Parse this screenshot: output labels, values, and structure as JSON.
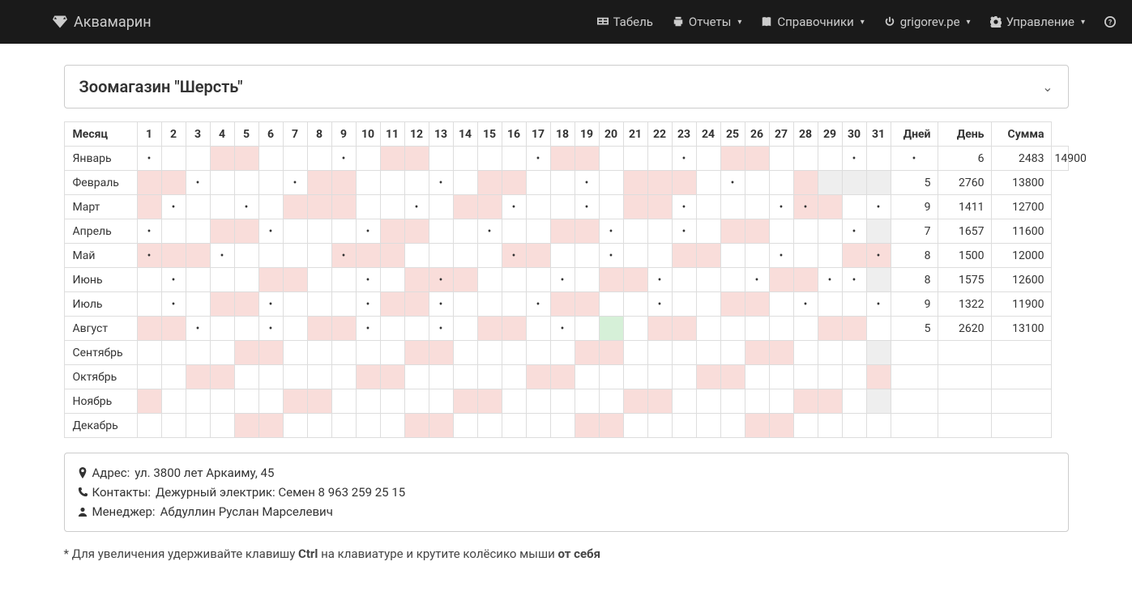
{
  "nav": {
    "brand": "Аквамарин",
    "tabel": "Табель",
    "reports": "Отчеты",
    "refs": "Справочники",
    "user": "grigorev.pe",
    "manage": "Управление"
  },
  "shop_title": "Зоомагазин \"Шерсть\"",
  "headers": {
    "month": "Месяц",
    "days": "Дней",
    "day": "День",
    "sum": "Сумма"
  },
  "day_numbers": [
    "1",
    "2",
    "3",
    "4",
    "5",
    "6",
    "7",
    "8",
    "9",
    "10",
    "11",
    "12",
    "13",
    "14",
    "15",
    "16",
    "17",
    "18",
    "19",
    "20",
    "21",
    "22",
    "23",
    "24",
    "25",
    "26",
    "27",
    "28",
    "29",
    "30",
    "31"
  ],
  "months": [
    {
      "name": "Январь",
      "cells": [
        {
          "d": 1
        },
        {
          "d": 0
        },
        {
          "d": 0
        },
        {
          "p": 1
        },
        {
          "p": 1
        },
        {
          "d": 0
        },
        {
          "d": 0
        },
        {
          "d": 0
        },
        {
          "d": 1
        },
        {
          "d": 0
        },
        {
          "p": 1
        },
        {
          "p": 1
        },
        {
          "d": 0
        },
        {
          "d": 0
        },
        {
          "d": 0
        },
        {
          "d": 0
        },
        {
          "d": 1
        },
        {
          "p": 1
        },
        {
          "p": 1
        },
        {
          "d": 0
        },
        {
          "d": 0
        },
        {
          "d": 0
        },
        {
          "d": 1
        },
        {
          "d": 0
        },
        {
          "p": 1
        },
        {
          "p": 1
        },
        {
          "d": 0
        },
        {
          "d": 0
        },
        {
          "d": 0
        },
        {
          "d": 1
        },
        {
          "d": 0
        },
        {
          "d": 1
        }
      ],
      "stats": {
        "days": "6",
        "day": "2483",
        "sum": "14900"
      }
    },
    {
      "name": "Февраль",
      "cells": [
        {
          "p": 1
        },
        {
          "p": 1
        },
        {
          "d": 1
        },
        {
          "d": 0
        },
        {
          "d": 0
        },
        {
          "d": 0
        },
        {
          "d": 1
        },
        {
          "p": 1
        },
        {
          "p": 1
        },
        {
          "d": 0
        },
        {
          "d": 0
        },
        {
          "d": 0
        },
        {
          "d": 1
        },
        {
          "d": 0
        },
        {
          "p": 1
        },
        {
          "p": 1
        },
        {
          "d": 0
        },
        {
          "d": 0
        },
        {
          "d": 1
        },
        {
          "d": 0
        },
        {
          "p": 1
        },
        {
          "p": 1
        },
        {
          "p": 1
        },
        {
          "d": 0
        },
        {
          "d": 1
        },
        {
          "d": 0
        },
        {
          "d": 0
        },
        {
          "p": 1
        },
        {
          "g": 1
        },
        {
          "g": 1
        },
        {
          "g": 1
        }
      ],
      "stats": {
        "days": "5",
        "day": "2760",
        "sum": "13800"
      }
    },
    {
      "name": "Март",
      "cells": [
        {
          "p": 1
        },
        {
          "d": 1
        },
        {
          "d": 0
        },
        {
          "d": 0
        },
        {
          "d": 1
        },
        {
          "d": 0
        },
        {
          "p": 1
        },
        {
          "p": 1
        },
        {
          "p": 1
        },
        {
          "d": 0
        },
        {
          "d": 0
        },
        {
          "d": 1
        },
        {
          "d": 0
        },
        {
          "p": 1
        },
        {
          "p": 1
        },
        {
          "d": 1
        },
        {
          "d": 0
        },
        {
          "d": 0
        },
        {
          "d": 1
        },
        {
          "d": 0
        },
        {
          "p": 1
        },
        {
          "p": 1
        },
        {
          "d": 1
        },
        {
          "d": 0
        },
        {
          "d": 0
        },
        {
          "d": 0
        },
        {
          "d": 1
        },
        {
          "p": 1,
          "d": 1
        },
        {
          "p": 1
        },
        {
          "d": 0
        },
        {
          "d": 1
        }
      ],
      "stats": {
        "days": "9",
        "day": "1411",
        "sum": "12700"
      }
    },
    {
      "name": "Апрель",
      "cells": [
        {
          "d": 1
        },
        {
          "d": 0
        },
        {
          "d": 0
        },
        {
          "p": 1
        },
        {
          "p": 1
        },
        {
          "d": 1
        },
        {
          "d": 0
        },
        {
          "d": 0
        },
        {
          "d": 0
        },
        {
          "d": 1
        },
        {
          "p": 1
        },
        {
          "p": 1
        },
        {
          "d": 0
        },
        {
          "d": 0
        },
        {
          "d": 1
        },
        {
          "d": 0
        },
        {
          "d": 0
        },
        {
          "p": 1
        },
        {
          "p": 1
        },
        {
          "d": 1
        },
        {
          "d": 0
        },
        {
          "d": 0
        },
        {
          "d": 1
        },
        {
          "d": 0
        },
        {
          "p": 1
        },
        {
          "p": 1
        },
        {
          "d": 0
        },
        {
          "d": 0
        },
        {
          "d": 0
        },
        {
          "d": 1
        },
        {
          "g": 1
        }
      ],
      "stats": {
        "days": "7",
        "day": "1657",
        "sum": "11600"
      }
    },
    {
      "name": "Май",
      "cells": [
        {
          "p": 1,
          "d": 1
        },
        {
          "p": 1
        },
        {
          "p": 1
        },
        {
          "d": 1
        },
        {
          "d": 0
        },
        {
          "d": 0
        },
        {
          "d": 0
        },
        {
          "d": 0
        },
        {
          "p": 1,
          "d": 1
        },
        {
          "p": 1
        },
        {
          "p": 1
        },
        {
          "d": 0
        },
        {
          "d": 0
        },
        {
          "d": 0
        },
        {
          "d": 0
        },
        {
          "p": 1,
          "d": 1
        },
        {
          "p": 1
        },
        {
          "d": 0
        },
        {
          "d": 0
        },
        {
          "d": 1
        },
        {
          "d": 0
        },
        {
          "d": 0
        },
        {
          "p": 1
        },
        {
          "p": 1
        },
        {
          "d": 0
        },
        {
          "d": 0
        },
        {
          "d": 1
        },
        {
          "d": 0
        },
        {
          "d": 0
        },
        {
          "p": 1
        },
        {
          "p": 1,
          "d": 1
        }
      ],
      "stats": {
        "days": "8",
        "day": "1500",
        "sum": "12000"
      }
    },
    {
      "name": "Июнь",
      "cells": [
        {
          "d": 0
        },
        {
          "d": 1
        },
        {
          "d": 0
        },
        {
          "d": 0
        },
        {
          "d": 0
        },
        {
          "p": 1
        },
        {
          "p": 1
        },
        {
          "d": 0
        },
        {
          "d": 0
        },
        {
          "d": 1
        },
        {
          "d": 0
        },
        {
          "p": 1
        },
        {
          "p": 1,
          "d": 1
        },
        {
          "p": 1
        },
        {
          "d": 0
        },
        {
          "d": 0
        },
        {
          "d": 0
        },
        {
          "d": 1
        },
        {
          "d": 0
        },
        {
          "p": 1
        },
        {
          "p": 1
        },
        {
          "d": 1
        },
        {
          "d": 0
        },
        {
          "d": 0
        },
        {
          "d": 0
        },
        {
          "d": 1
        },
        {
          "p": 1
        },
        {
          "p": 1
        },
        {
          "d": 1
        },
        {
          "d": 1
        },
        {
          "g": 1
        }
      ],
      "stats": {
        "days": "8",
        "day": "1575",
        "sum": "12600"
      }
    },
    {
      "name": "Июль",
      "cells": [
        {
          "d": 0
        },
        {
          "d": 1
        },
        {
          "d": 0
        },
        {
          "p": 1
        },
        {
          "p": 1
        },
        {
          "d": 1
        },
        {
          "d": 0
        },
        {
          "d": 0
        },
        {
          "d": 0
        },
        {
          "d": 1
        },
        {
          "p": 1
        },
        {
          "p": 1
        },
        {
          "d": 1
        },
        {
          "d": 0
        },
        {
          "d": 0
        },
        {
          "d": 0
        },
        {
          "d": 1
        },
        {
          "p": 1
        },
        {
          "p": 1
        },
        {
          "d": 0
        },
        {
          "d": 0
        },
        {
          "d": 1
        },
        {
          "d": 0
        },
        {
          "d": 0
        },
        {
          "p": 1
        },
        {
          "p": 1
        },
        {
          "d": 0
        },
        {
          "d": 1
        },
        {
          "d": 0
        },
        {
          "d": 0
        },
        {
          "d": 1
        }
      ],
      "stats": {
        "days": "9",
        "day": "1322",
        "sum": "11900"
      }
    },
    {
      "name": "Август",
      "cells": [
        {
          "p": 1
        },
        {
          "p": 1
        },
        {
          "d": 1
        },
        {
          "d": 0
        },
        {
          "d": 0
        },
        {
          "d": 1
        },
        {
          "d": 0
        },
        {
          "p": 1
        },
        {
          "p": 1
        },
        {
          "d": 1
        },
        {
          "d": 0
        },
        {
          "d": 0
        },
        {
          "d": 1
        },
        {
          "d": 0
        },
        {
          "p": 1
        },
        {
          "p": 1
        },
        {
          "d": 0
        },
        {
          "d": 1
        },
        {
          "d": 0
        },
        {
          "gr": 1
        },
        {
          "d": 0
        },
        {
          "p": 1
        },
        {
          "p": 1
        },
        {
          "d": 0
        },
        {
          "d": 0
        },
        {
          "d": 0
        },
        {
          "d": 0
        },
        {
          "d": 0
        },
        {
          "p": 1
        },
        {
          "p": 1
        },
        {
          "d": 0
        }
      ],
      "stats": {
        "days": "5",
        "day": "2620",
        "sum": "13100"
      }
    },
    {
      "name": "Сентябрь",
      "cells": [
        {
          "d": 0
        },
        {
          "d": 0
        },
        {
          "d": 0
        },
        {
          "d": 0
        },
        {
          "p": 1
        },
        {
          "p": 1
        },
        {
          "d": 0
        },
        {
          "d": 0
        },
        {
          "d": 0
        },
        {
          "d": 0
        },
        {
          "d": 0
        },
        {
          "p": 1
        },
        {
          "p": 1
        },
        {
          "d": 0
        },
        {
          "d": 0
        },
        {
          "d": 0
        },
        {
          "d": 0
        },
        {
          "d": 0
        },
        {
          "p": 1
        },
        {
          "p": 1
        },
        {
          "d": 0
        },
        {
          "d": 0
        },
        {
          "d": 0
        },
        {
          "d": 0
        },
        {
          "d": 0
        },
        {
          "p": 1
        },
        {
          "p": 1
        },
        {
          "d": 0
        },
        {
          "d": 0
        },
        {
          "d": 0
        },
        {
          "g": 1
        }
      ],
      "stats": {
        "days": "",
        "day": "",
        "sum": ""
      }
    },
    {
      "name": "Октябрь",
      "cells": [
        {
          "d": 0
        },
        {
          "d": 0
        },
        {
          "p": 1
        },
        {
          "p": 1
        },
        {
          "d": 0
        },
        {
          "d": 0
        },
        {
          "d": 0
        },
        {
          "d": 0
        },
        {
          "d": 0
        },
        {
          "p": 1
        },
        {
          "p": 1
        },
        {
          "d": 0
        },
        {
          "d": 0
        },
        {
          "d": 0
        },
        {
          "d": 0
        },
        {
          "d": 0
        },
        {
          "p": 1
        },
        {
          "p": 1
        },
        {
          "d": 0
        },
        {
          "d": 0
        },
        {
          "d": 0
        },
        {
          "d": 0
        },
        {
          "d": 0
        },
        {
          "p": 1
        },
        {
          "p": 1
        },
        {
          "d": 0
        },
        {
          "d": 0
        },
        {
          "d": 0
        },
        {
          "d": 0
        },
        {
          "d": 0
        },
        {
          "p": 1
        }
      ],
      "stats": {
        "days": "",
        "day": "",
        "sum": ""
      }
    },
    {
      "name": "Ноябрь",
      "cells": [
        {
          "p": 1
        },
        {
          "d": 0
        },
        {
          "d": 0
        },
        {
          "d": 0
        },
        {
          "d": 0
        },
        {
          "d": 0
        },
        {
          "p": 1
        },
        {
          "p": 1
        },
        {
          "d": 0
        },
        {
          "d": 0
        },
        {
          "d": 0
        },
        {
          "d": 0
        },
        {
          "d": 0
        },
        {
          "p": 1
        },
        {
          "p": 1
        },
        {
          "d": 0
        },
        {
          "d": 0
        },
        {
          "d": 0
        },
        {
          "d": 0
        },
        {
          "d": 0
        },
        {
          "p": 1
        },
        {
          "p": 1
        },
        {
          "d": 0
        },
        {
          "d": 0
        },
        {
          "d": 0
        },
        {
          "d": 0
        },
        {
          "d": 0
        },
        {
          "p": 1
        },
        {
          "p": 1
        },
        {
          "d": 0
        },
        {
          "g": 1
        }
      ],
      "stats": {
        "days": "",
        "day": "",
        "sum": ""
      }
    },
    {
      "name": "Декабрь",
      "cells": [
        {
          "d": 0
        },
        {
          "d": 0
        },
        {
          "d": 0
        },
        {
          "d": 0
        },
        {
          "p": 1
        },
        {
          "p": 1
        },
        {
          "d": 0
        },
        {
          "d": 0
        },
        {
          "d": 0
        },
        {
          "d": 0
        },
        {
          "d": 0
        },
        {
          "p": 1
        },
        {
          "p": 1
        },
        {
          "d": 0
        },
        {
          "d": 0
        },
        {
          "d": 0
        },
        {
          "d": 0
        },
        {
          "d": 0
        },
        {
          "p": 1
        },
        {
          "p": 1
        },
        {
          "d": 0
        },
        {
          "d": 0
        },
        {
          "d": 0
        },
        {
          "d": 0
        },
        {
          "d": 0
        },
        {
          "p": 1
        },
        {
          "p": 1
        },
        {
          "d": 0
        },
        {
          "d": 0
        },
        {
          "d": 0
        },
        {
          "d": 0
        }
      ],
      "stats": {
        "days": "",
        "day": "",
        "sum": ""
      }
    }
  ],
  "info": {
    "address_label": "Адрес:",
    "address": "ул. 3800 лет Аркаиму, 45",
    "contacts_label": "Контакты:",
    "contacts": "Дежурный электрик: Семен 8 963 259 25 15",
    "manager_label": "Менеджер:",
    "manager": "Абдуллин Руслан Марселевич"
  },
  "hint": {
    "prefix": "* Для увеличения удерживайте клавишу ",
    "ctrl": "Ctrl",
    "middle": " на клавиатуре и крутите колёсико мыши ",
    "away": "от себя"
  }
}
